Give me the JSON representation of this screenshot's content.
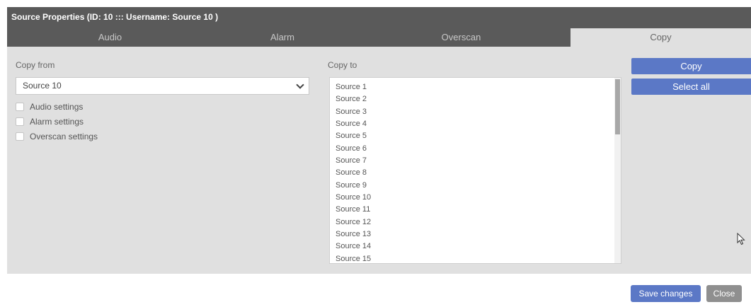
{
  "dialog": {
    "title": "Source Properties (ID: 10 ::: Username: Source 10 )",
    "tabs": [
      {
        "label": "Audio",
        "active": false
      },
      {
        "label": "Alarm",
        "active": false
      },
      {
        "label": "Overscan",
        "active": false
      },
      {
        "label": "Copy",
        "active": true
      }
    ]
  },
  "copy_from": {
    "label": "Copy from",
    "selected": "Source 10",
    "options": [
      {
        "label": "Audio settings",
        "checked": false
      },
      {
        "label": "Alarm settings",
        "checked": false
      },
      {
        "label": "Overscan settings",
        "checked": false
      }
    ]
  },
  "copy_to": {
    "label": "Copy to",
    "items": [
      "Source 1",
      "Source 2",
      "Source 3",
      "Source 4",
      "Source 5",
      "Source 6",
      "Source 7",
      "Source 8",
      "Source 9",
      "Source 10",
      "Source 11",
      "Source 12",
      "Source 13",
      "Source 14",
      "Source 15"
    ]
  },
  "actions": {
    "copy": "Copy",
    "select_all": "Select all"
  },
  "footer": {
    "save": "Save changes",
    "close": "Close"
  },
  "colors": {
    "accent": "#5b78c6",
    "titlebar": "#5a5a5a",
    "panel": "#e0e0e0",
    "close_button": "#8f8f8f"
  }
}
